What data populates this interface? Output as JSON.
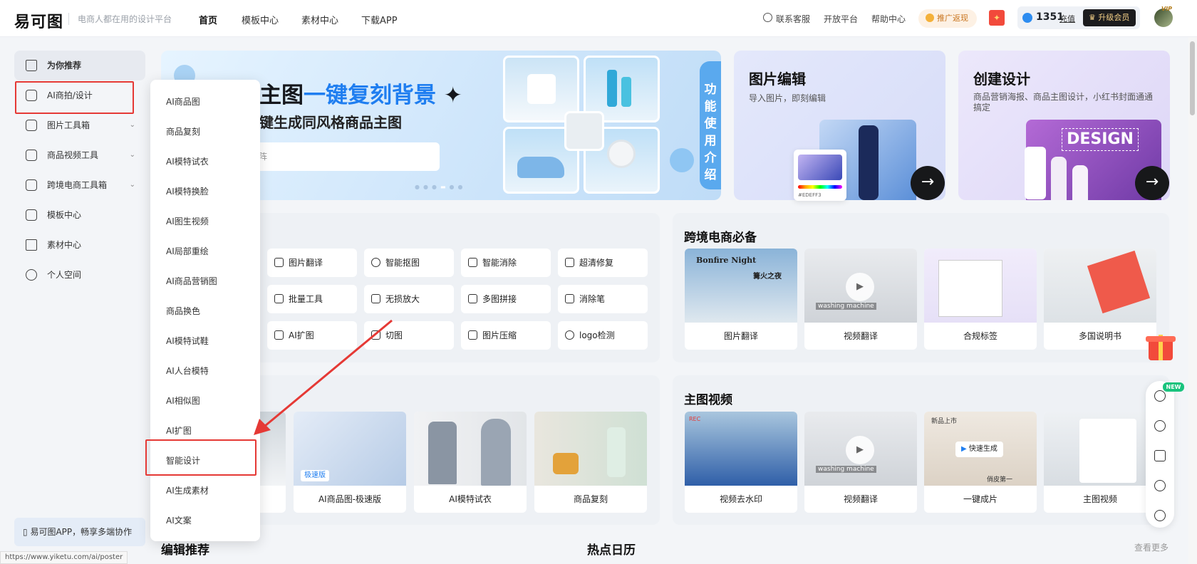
{
  "header": {
    "logo": "易可图",
    "slogan": "电商人都在用的设计平台",
    "nav": [
      "首页",
      "模板中心",
      "素材中心",
      "下载APP"
    ],
    "links": [
      "联系客服",
      "开放平台",
      "帮助中心"
    ],
    "promo": "推广返现",
    "credits": "1351",
    "recharge": "充值",
    "upgrade": "升级会员",
    "vip": "VIP"
  },
  "sidebar": {
    "items": [
      {
        "label": "为你推荐",
        "icon": "home-icon"
      },
      {
        "label": "AI商拍/设计",
        "icon": "ai-icon"
      },
      {
        "label": "图片工具箱",
        "icon": "toolbox-icon"
      },
      {
        "label": "商品视频工具",
        "icon": "video-icon"
      },
      {
        "label": "跨境电商工具箱",
        "icon": "crossborder-icon"
      },
      {
        "label": "模板中心",
        "icon": "template-icon"
      },
      {
        "label": "素材中心",
        "icon": "material-icon"
      },
      {
        "label": "个人空间",
        "icon": "user-icon"
      }
    ],
    "app_promo": "易可图APP，畅享多端协作"
  },
  "dropdown": {
    "items": [
      "AI商品图",
      "商品复刻",
      "AI模特试衣",
      "AI模特换脸",
      "AI图生视频",
      "AI局部重绘",
      "AI商品营销图",
      "商品换色",
      "AI模特试鞋",
      "AI人台模特",
      "AI相似图",
      "AI扩图",
      "智能设计",
      "AI生成素材",
      "AI文案"
    ],
    "highlighted": "智能设计"
  },
  "banner": {
    "title_a": "主图",
    "title_b": "一键复刻背景",
    "subtitle": "键生成同风格商品主图",
    "input_placeholder": "阵",
    "side_label": "功能使用介绍"
  },
  "cards": [
    {
      "title": "图片编辑",
      "subtitle": "导入图片，即刻编辑",
      "swatch_hex": "#EDEFF3"
    },
    {
      "title": "创建设计",
      "subtitle": "商品营销海报、商品主图设计，小红书封面通通搞定",
      "badge": "DESIGN"
    }
  ],
  "tools": [
    [
      "图片翻译",
      "智能抠图",
      "智能消除",
      "超清修复"
    ],
    [
      "批量工具",
      "无损放大",
      "多图拼接",
      "消除笔"
    ],
    [
      "AI扩图",
      "切图",
      "图片压缩",
      "logo检测"
    ]
  ],
  "crossborder": {
    "title": "跨境电商必备",
    "items": [
      "图片翻译",
      "视频翻译",
      "合规标签",
      "多国说明书"
    ],
    "thumb_texts": [
      "Bonfire Night",
      "篝火之夜",
      "washing machine"
    ]
  },
  "ai_row": {
    "items": [
      "AI商品图-极速版",
      "AI模特试衣",
      "商品复刻"
    ],
    "badge": "极速版"
  },
  "main_video": {
    "title": "主图视频",
    "items": [
      "视频去水印",
      "视频翻译",
      "一键成片",
      "主图视频"
    ],
    "thumb_texts": [
      "新品上市",
      "快速生成",
      "俏皮第一",
      "REC"
    ]
  },
  "bottom": {
    "edit_rec": "编辑推荐",
    "hot_calendar": "热点日历",
    "see_more": "查看更多"
  },
  "float_bar": {
    "new_badge": "NEW"
  },
  "status_url": "https://www.yiketu.com/ai/poster",
  "colors": {
    "accent": "#1f7ef0",
    "highlight": "#e53935",
    "dark": "#17181a"
  }
}
